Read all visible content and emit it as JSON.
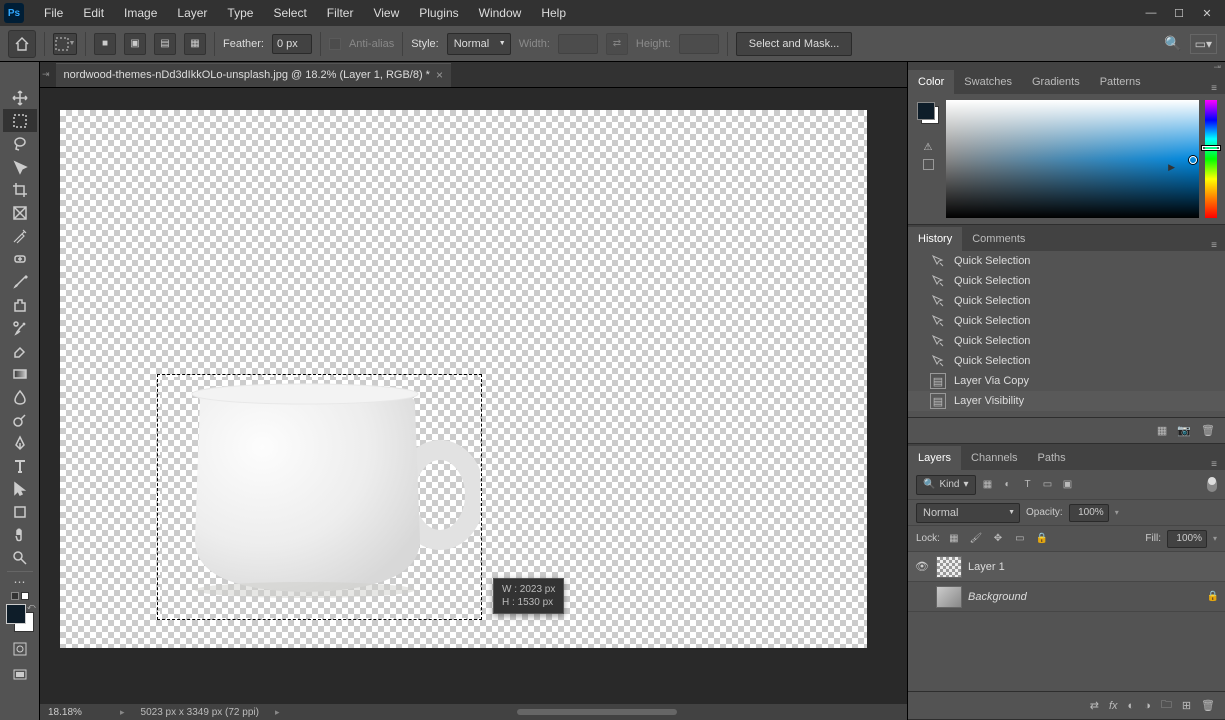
{
  "app": {
    "logo": "Ps"
  },
  "menu": [
    "File",
    "Edit",
    "Image",
    "Layer",
    "Type",
    "Select",
    "Filter",
    "View",
    "Plugins",
    "Window",
    "Help"
  ],
  "options": {
    "feather_label": "Feather:",
    "feather_value": "0 px",
    "anti_alias": "Anti-alias",
    "style_label": "Style:",
    "style_value": "Normal",
    "width_label": "Width:",
    "height_label": "Height:",
    "mask_btn": "Select and Mask..."
  },
  "doc": {
    "tab_title": "nordwood-themes-nDd3dIkkOLo-unsplash.jpg @ 18.2% (Layer 1, RGB/8) *"
  },
  "status": {
    "zoom": "18.18%",
    "doc_info": "5023 px x 3349 px (72 ppi)"
  },
  "info_box": {
    "w": "W :  2023 px",
    "h": "H :  1530 px"
  },
  "panels": {
    "color_tabs": [
      "Color",
      "Swatches",
      "Gradients",
      "Patterns"
    ],
    "history_tabs": [
      "History",
      "Comments"
    ],
    "layers_tabs": [
      "Layers",
      "Channels",
      "Paths"
    ]
  },
  "history": [
    {
      "icon": "wand",
      "label": "Quick Selection"
    },
    {
      "icon": "wand",
      "label": "Quick Selection"
    },
    {
      "icon": "wand",
      "label": "Quick Selection"
    },
    {
      "icon": "wand",
      "label": "Quick Selection"
    },
    {
      "icon": "wand",
      "label": "Quick Selection"
    },
    {
      "icon": "wand",
      "label": "Quick Selection"
    },
    {
      "icon": "doc",
      "label": "Layer Via Copy"
    },
    {
      "icon": "doc",
      "label": "Layer Visibility",
      "active": true
    }
  ],
  "layers": {
    "filter_kind_label": "Kind",
    "blend_mode": "Normal",
    "opacity_label": "Opacity:",
    "opacity_value": "100%",
    "lock_label": "Lock:",
    "fill_label": "Fill:",
    "fill_value": "100%",
    "items": [
      {
        "name": "Layer 1",
        "visible": true,
        "selected": true,
        "thumb": "checker"
      },
      {
        "name": "Background",
        "visible": false,
        "locked": true,
        "italic": true,
        "thumb": "bg"
      }
    ]
  }
}
